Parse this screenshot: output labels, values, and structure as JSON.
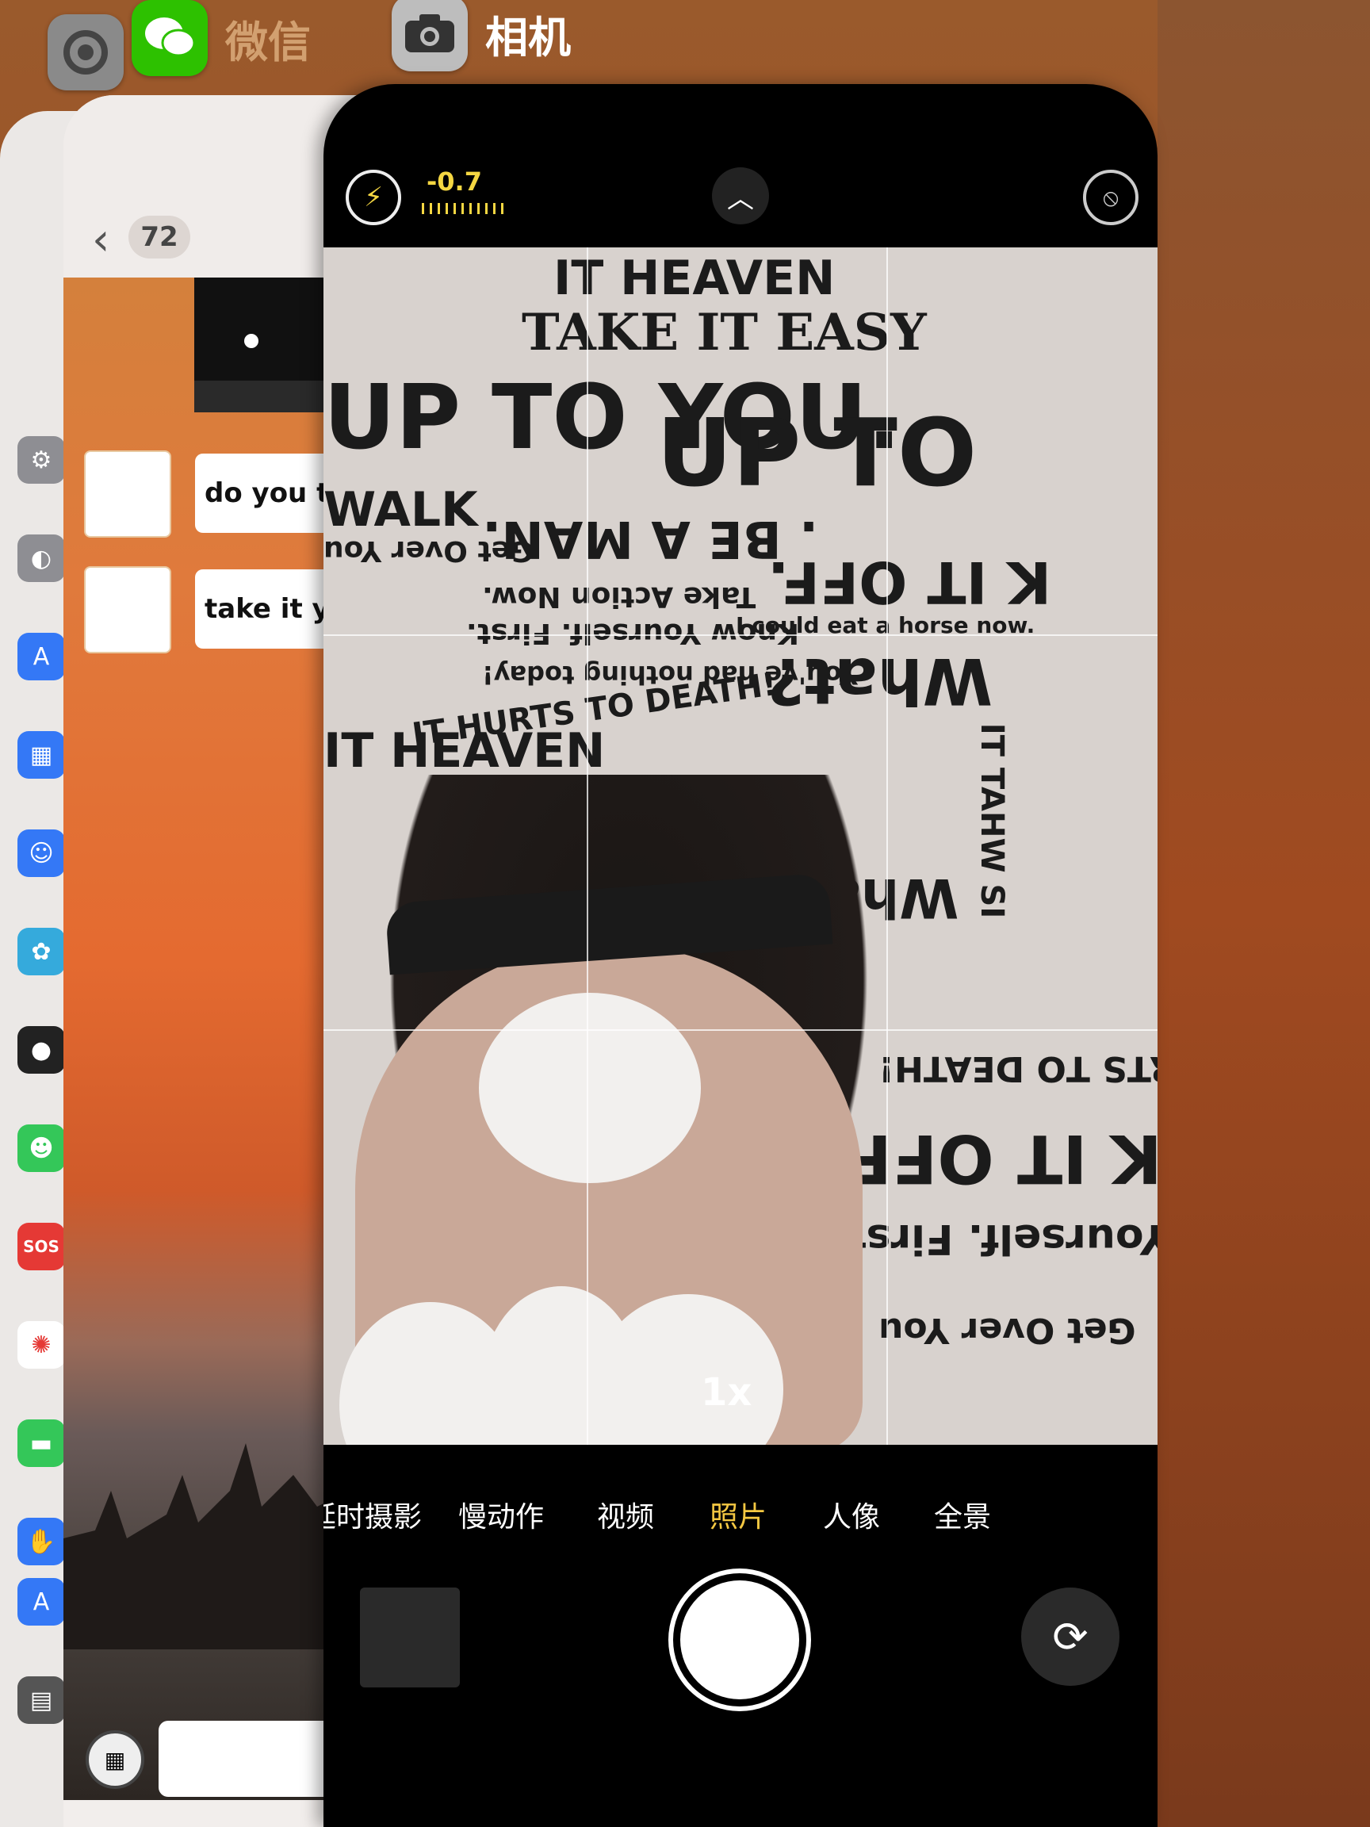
{
  "switcher": {
    "wechat_label": "微信",
    "camera_label": "相机"
  },
  "chat": {
    "unread_count": "72",
    "messages": [
      {
        "text": "do you th"
      },
      {
        "text": "take it y"
      }
    ]
  },
  "camera": {
    "exposure": "-0.7",
    "zoom": "1x",
    "modes": [
      "延时摄影",
      "慢动作",
      "视频",
      "照片",
      "人像",
      "全景"
    ],
    "active_mode": "照片"
  },
  "poster": {
    "lines": [
      "IT HEAVEN",
      "TAKE IT EASY",
      "UP TO YOU.",
      "UP TO",
      "WALK",
      "Get Over You",
      ". BE A MAN.",
      "K IT OFF.",
      "Take Action Now.",
      "Know Yourself. First.",
      "You've had nothing today!",
      "What?",
      "IT HURTS TO DEATH!",
      "Get Over You",
      "IT TAHW SI",
      "I could eat a horse now."
    ]
  },
  "colors": {
    "accent_yellow": "#f5c842",
    "wechat_green": "#2dc100"
  }
}
